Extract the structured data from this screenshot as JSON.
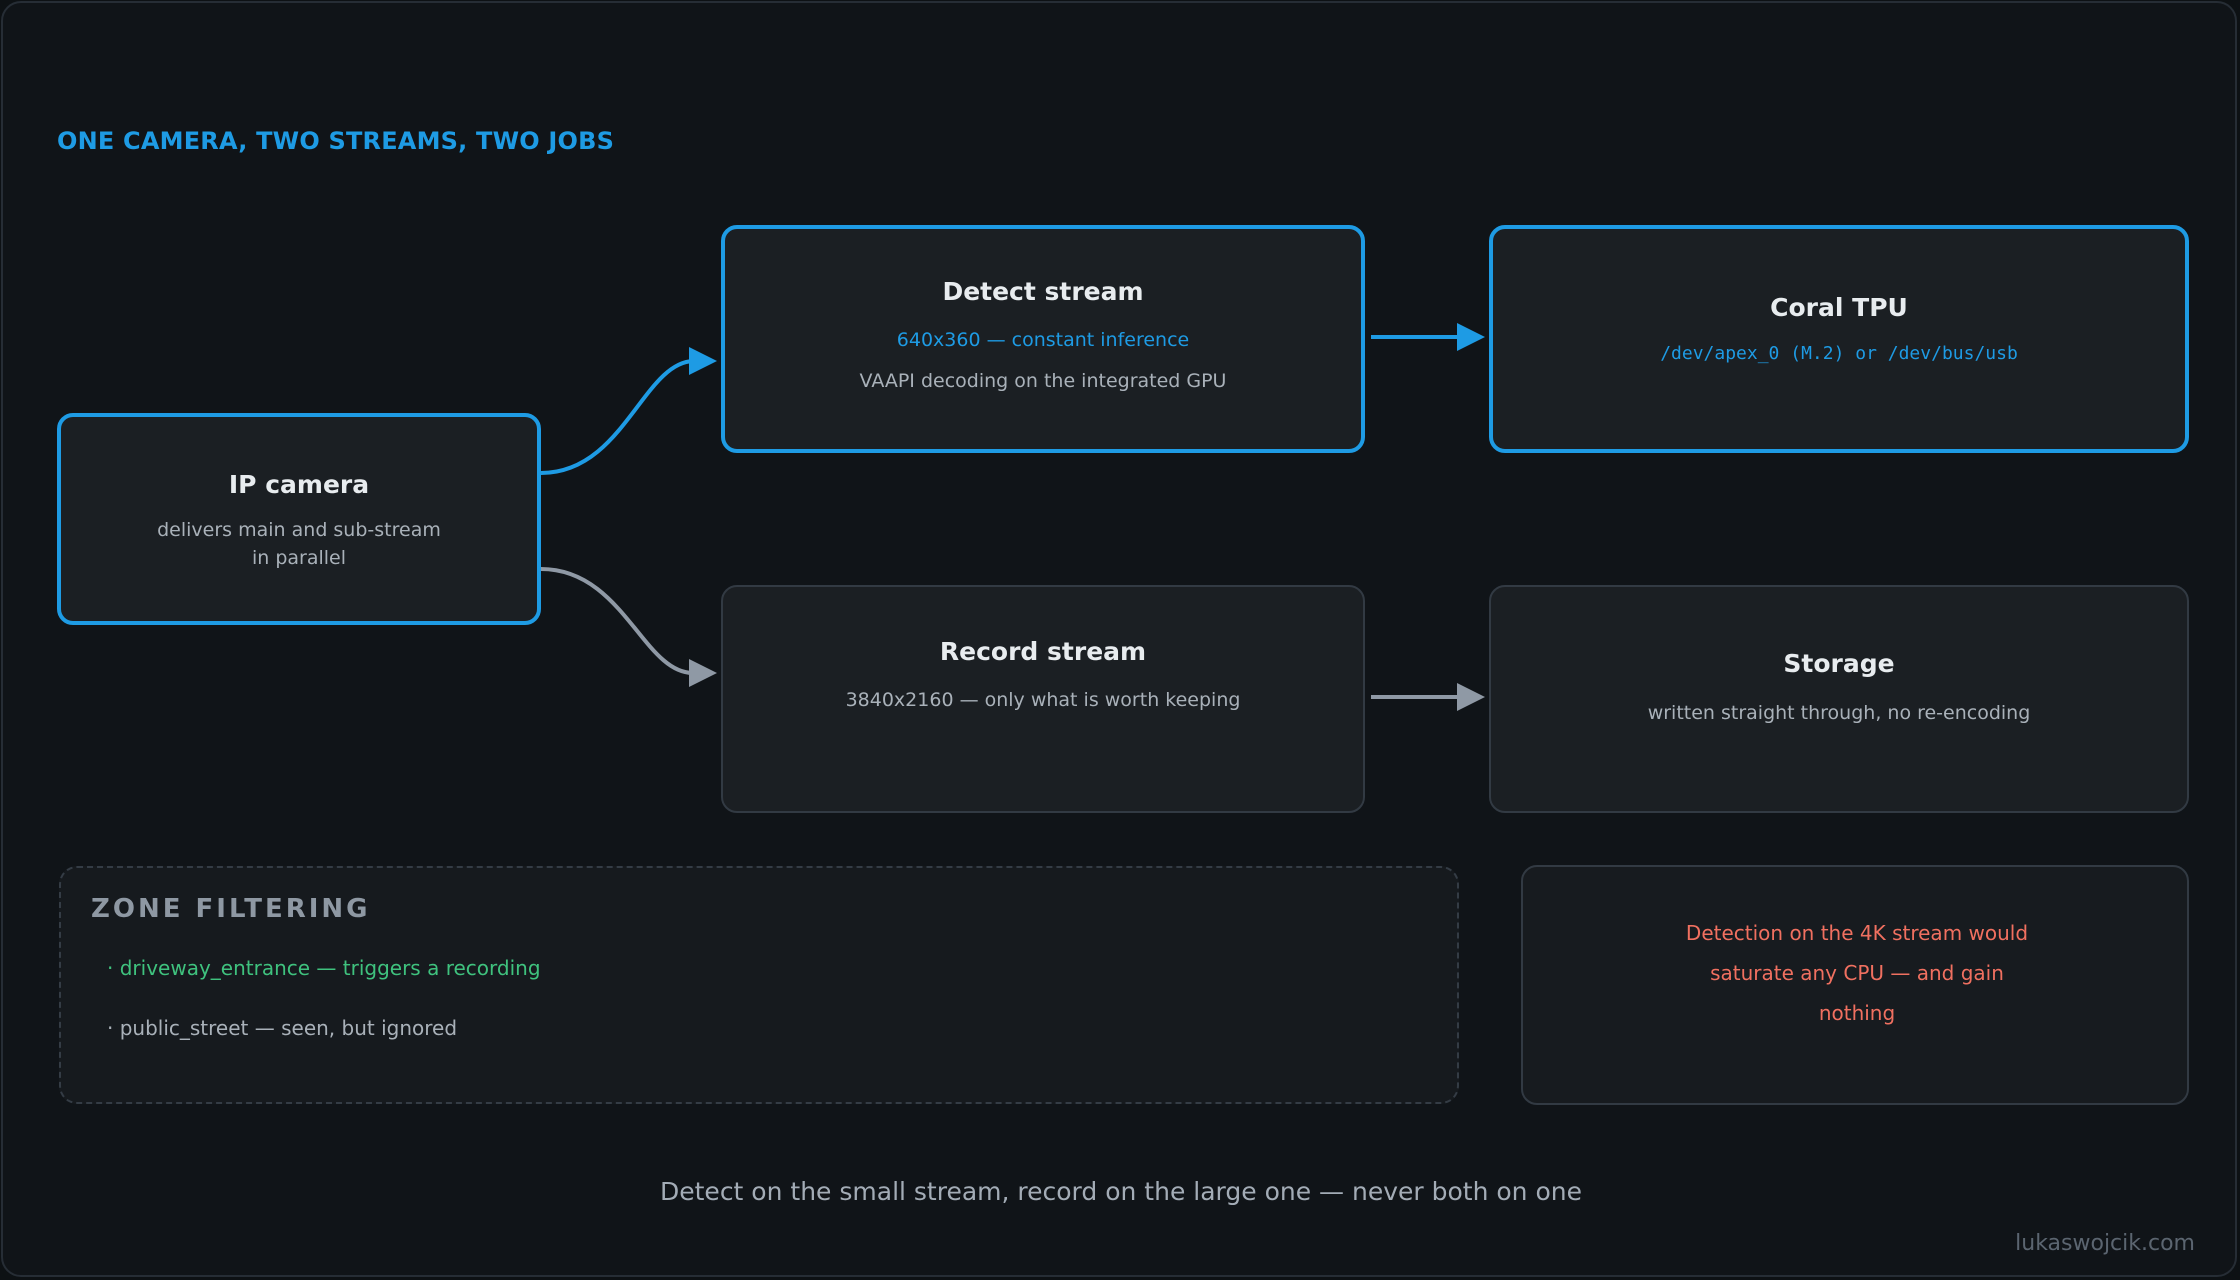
{
  "heading": "ONE CAMERA, TWO STREAMS, TWO JOBS",
  "nodes": {
    "camera": {
      "title": "IP camera",
      "lines": [
        "delivers main and sub-stream",
        "in parallel"
      ]
    },
    "detect": {
      "title": "Detect stream",
      "spec": "640x360 — constant inference",
      "note": "VAAPI decoding on the integrated GPU"
    },
    "coral": {
      "title": "Coral TPU",
      "device": "/dev/apex_0 (M.2) or /dev/bus/usb"
    },
    "record": {
      "title": "Record stream",
      "spec": "3840x2160 — only what is worth keeping"
    },
    "storage": {
      "title": "Storage",
      "note": "written straight through, no re-encoding"
    }
  },
  "zones": {
    "title": "ZONE FILTERING",
    "items": [
      "· driveway_entrance — triggers a recording",
      "· public_street — seen, but ignored"
    ]
  },
  "warning": "Detection on the 4K stream would saturate any CPU — and gain nothing",
  "caption": "Detect on the small stream, record on the large one — never both on one",
  "credit": "lukaswojcik.com",
  "colors": {
    "accent": "#1e9be4",
    "muted_arrow": "#8f99a5",
    "zone_active": "#3fc27e",
    "warning": "#f07060",
    "background": "#101418"
  }
}
